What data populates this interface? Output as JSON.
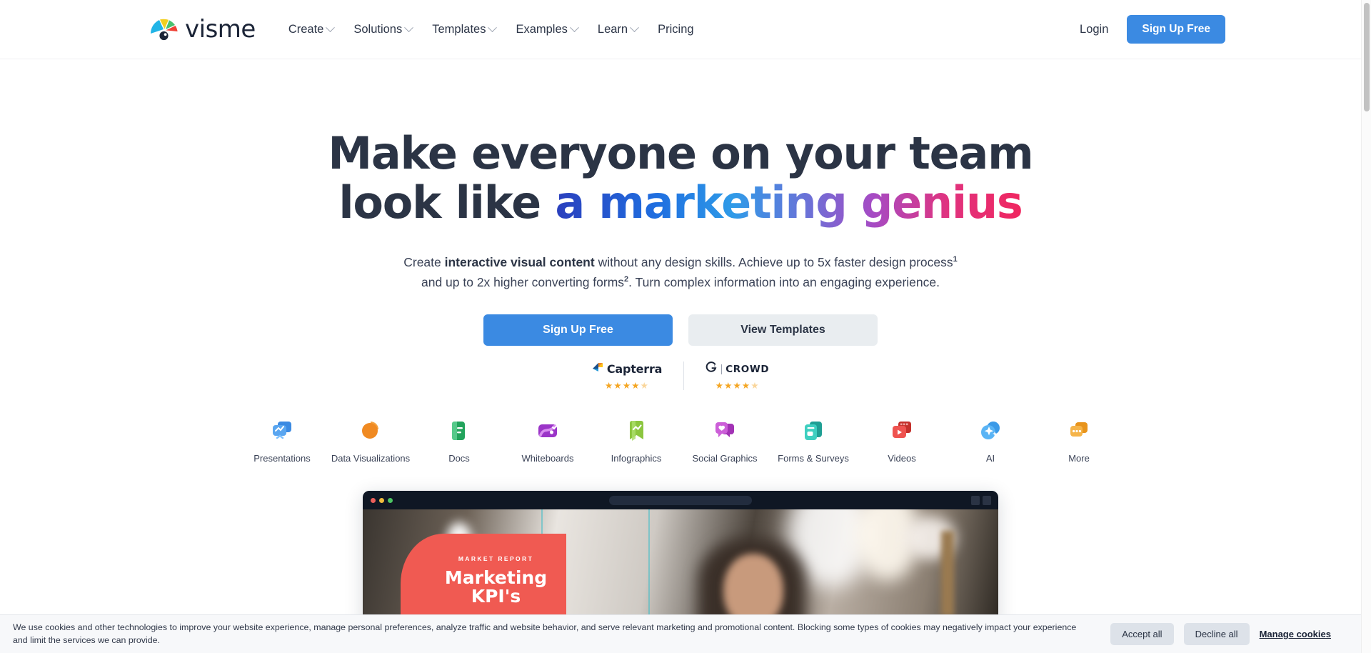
{
  "nav": {
    "logo_text": "visme",
    "logo_icon": "visme-fan-logo-icon",
    "links": [
      {
        "label": "Create",
        "has_caret": true
      },
      {
        "label": "Solutions",
        "has_caret": true
      },
      {
        "label": "Templates",
        "has_caret": true
      },
      {
        "label": "Examples",
        "has_caret": true
      },
      {
        "label": "Learn",
        "has_caret": true
      },
      {
        "label": "Pricing",
        "has_caret": false
      }
    ],
    "login_label": "Login",
    "signup_label": "Sign Up Free"
  },
  "hero": {
    "headline_line1": "Make everyone on your team",
    "headline_line2_plain": "look like ",
    "headline_line2_gradient": "a marketing genius",
    "subtitle_a": "Create ",
    "subtitle_bold": "interactive visual content",
    "subtitle_b": " without any design skills. Achieve up to 5x faster design process",
    "subtitle_sup1": "1",
    "subtitle_c": "and up to 2x higher converting forms",
    "subtitle_sup2": "2",
    "subtitle_d": ". Turn complex information into an engaging experience.",
    "cta_primary": "Sign Up Free",
    "cta_secondary": "View Templates"
  },
  "badges": [
    {
      "name": "Capterra",
      "icon": "capterra-logo-icon",
      "stars": "★★★★",
      "half": "★",
      "rating": 4.5
    },
    {
      "name": "CROWD",
      "icon": "g2-crowd-logo-icon",
      "stars": "★★★★",
      "half": "★",
      "rating": 4.5
    }
  ],
  "categories": [
    {
      "label": "Presentations",
      "icon": "presentations-icon",
      "color": "#3b8ae2"
    },
    {
      "label": "Data Visualizations",
      "icon": "data-visualizations-icon",
      "color": "#f08a22"
    },
    {
      "label": "Docs",
      "icon": "docs-icon",
      "color": "#22a35c"
    },
    {
      "label": "Whiteboards",
      "icon": "whiteboards-icon",
      "color": "#a040d0"
    },
    {
      "label": "Infographics",
      "icon": "infographics-icon",
      "color": "#8cc63f"
    },
    {
      "label": "Social Graphics",
      "icon": "social-graphics-icon",
      "color": "#c049c0"
    },
    {
      "label": "Forms & Surveys",
      "icon": "forms-surveys-icon",
      "color": "#2bbcae"
    },
    {
      "label": "Videos",
      "icon": "videos-icon",
      "color": "#e8413c"
    },
    {
      "label": "AI",
      "icon": "ai-sparkle-icon",
      "color": "#3b9ae8"
    },
    {
      "label": "More",
      "icon": "more-icon",
      "color": "#f0a830"
    }
  ],
  "mockup": {
    "dots": [
      "#ec5f5a",
      "#f0bc3e",
      "#4cc463"
    ],
    "kpi_eyebrow": "MARKET REPORT",
    "kpi_title_l1": "Marketing",
    "kpi_title_l2": "KPI's",
    "kpi_color": "#f05a52"
  },
  "cookie": {
    "text": "We use cookies and other technologies to improve your website experience, manage personal preferences, analyze traffic and website behavior, and serve relevant marketing and promotional content. Blocking some types of cookies may negatively impact your experience and limit the services we can provide.",
    "accept_label": "Accept all",
    "decline_label": "Decline all",
    "manage_label": "Manage cookies"
  },
  "colors": {
    "brand_blue": "#3b8ae2",
    "headline": "#2b3445",
    "star": "#f5a623"
  }
}
